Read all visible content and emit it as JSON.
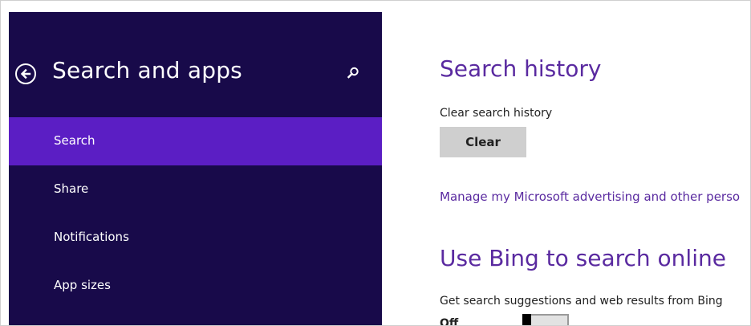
{
  "sidebar": {
    "title": "Search and apps",
    "back_icon": "back-arrow-circle-icon",
    "search_icon": "search-icon",
    "items": [
      {
        "label": "Search",
        "selected": true
      },
      {
        "label": "Share",
        "selected": false
      },
      {
        "label": "Notifications",
        "selected": false
      },
      {
        "label": "App sizes",
        "selected": false
      }
    ]
  },
  "content": {
    "search_history": {
      "title": "Search history",
      "clear_label": "Clear search history",
      "clear_button": "Clear",
      "manage_link": "Manage my Microsoft advertising and other perso"
    },
    "bing": {
      "title": "Use Bing to search online",
      "description": "Get search suggestions and web results from Bing",
      "toggle_state": "Off"
    }
  },
  "colors": {
    "sidebar_bg": "#180a4a",
    "selected_bg": "#5b1ec4",
    "accent_text": "#5a2aa0"
  }
}
